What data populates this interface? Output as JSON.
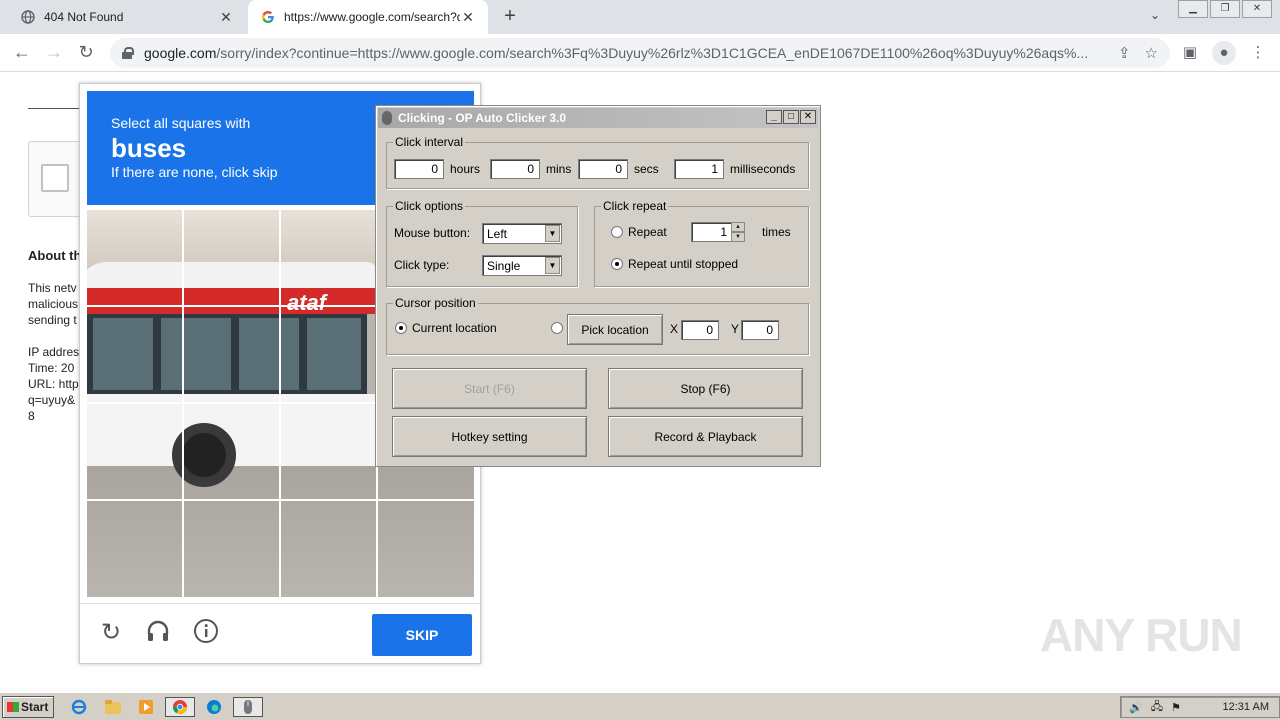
{
  "browser": {
    "tabs": [
      {
        "title": "404 Not Found",
        "active": false
      },
      {
        "title": "https://www.google.com/search?q=",
        "active": true
      }
    ],
    "new_tab": "+",
    "address": {
      "domain": "google.com",
      "path": "/sorry/index?continue=https://www.google.com/search%3Fq%3Duyuy%26rlz%3D1C1GCEA_enDE1067DE1100%26oq%3Duyuy%26aqs%..."
    }
  },
  "page": {
    "about_heading": "About th",
    "para1": [
      "This netv",
      "malicious",
      "sending t"
    ],
    "para2": [
      "IP addres",
      "Time: 20",
      "URL: http",
      "q=uyuy&",
      "8"
    ]
  },
  "captcha": {
    "instruction": "Select all squares with",
    "target": "buses",
    "hint": "If there are none, click skip",
    "bus_logo": "ataf",
    "skip_label": "SKIP",
    "icons": [
      "reload-icon",
      "headphones-icon",
      "info-icon"
    ]
  },
  "clicker": {
    "title": "Clicking - OP Auto Clicker 3.0",
    "click_interval": {
      "legend": "Click interval",
      "hours": "0",
      "hours_label": "hours",
      "mins": "0",
      "mins_label": "mins",
      "secs": "0",
      "secs_label": "secs",
      "ms": "1",
      "ms_label": "milliseconds"
    },
    "click_options": {
      "legend": "Click options",
      "mouse_label": "Mouse button:",
      "mouse_value": "Left",
      "type_label": "Click type:",
      "type_value": "Single"
    },
    "click_repeat": {
      "legend": "Click repeat",
      "repeat_label": "Repeat",
      "repeat_value": "1",
      "times_label": "times",
      "until_stopped_label": "Repeat until stopped",
      "selected": "until_stopped"
    },
    "cursor_position": {
      "legend": "Cursor position",
      "current_label": "Current location",
      "pick_label": "Pick location",
      "x_label": "X",
      "x_value": "0",
      "y_label": "Y",
      "y_value": "0",
      "selected": "current"
    },
    "buttons": {
      "start": "Start (F6)",
      "stop": "Stop (F6)",
      "hotkey": "Hotkey setting",
      "record": "Record & Playback"
    }
  },
  "watermark": "ANY RUN",
  "taskbar": {
    "start": "Start",
    "clock": "12:31 AM"
  }
}
